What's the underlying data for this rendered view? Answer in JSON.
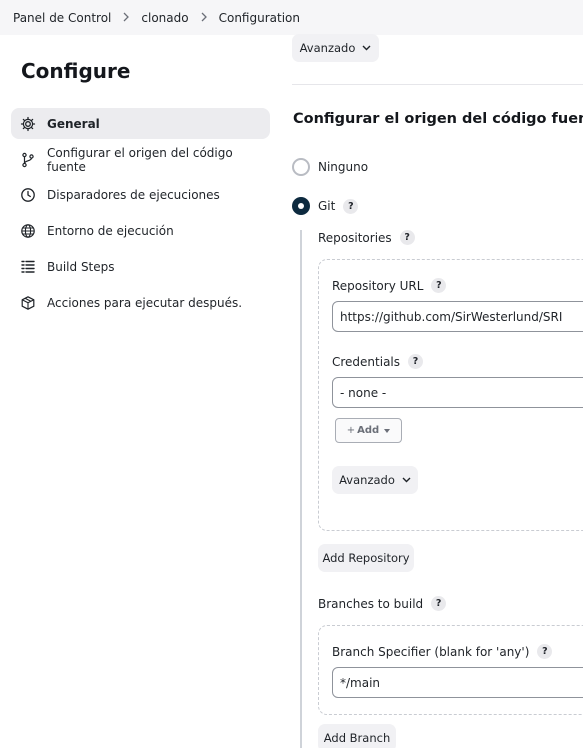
{
  "breadcrumb": {
    "items": [
      "Panel de Control",
      "clonado",
      "Configuration"
    ],
    "separator": ">"
  },
  "sidebar": {
    "title": "Configure",
    "items": [
      {
        "label": "General",
        "icon": "gear-icon",
        "active": true
      },
      {
        "label": "Configurar el origen del código fuente",
        "icon": "branch-icon"
      },
      {
        "label": "Disparadores de ejecuciones",
        "icon": "clock-icon"
      },
      {
        "label": "Entorno de ejecución",
        "icon": "globe-icon"
      },
      {
        "label": "Build Steps",
        "icon": "list-icon"
      },
      {
        "label": "Acciones para ejecutar después.",
        "icon": "package-icon"
      }
    ]
  },
  "main": {
    "top_advanced_label": "Avanzado",
    "section_title": "Configurar el origen del código fuente",
    "scm_options": [
      {
        "label": "Ninguno",
        "selected": false
      },
      {
        "label": "Git",
        "selected": true,
        "help": "?"
      }
    ],
    "repositories": {
      "label": "Repositories",
      "help": "?",
      "url_label": "Repository URL",
      "url_value": "https://github.com/SirWesterlund/SRI",
      "credentials_label": "Credentials",
      "credentials_value": "- none -",
      "add_label": "Add",
      "advanced_label": "Avanzado",
      "add_repository_label": "Add Repository"
    },
    "branches": {
      "label": "Branches to build",
      "help": "?",
      "specifier_label": "Branch Specifier (blank for 'any')",
      "specifier_value": "*/main",
      "add_branch_label": "Add Branch"
    }
  },
  "colors": {
    "accent": "#0d2a3f",
    "active_bg": "#ececef",
    "breadcrumb_bg": "#f6f6f8",
    "button_bg": "#f1f1f4"
  }
}
